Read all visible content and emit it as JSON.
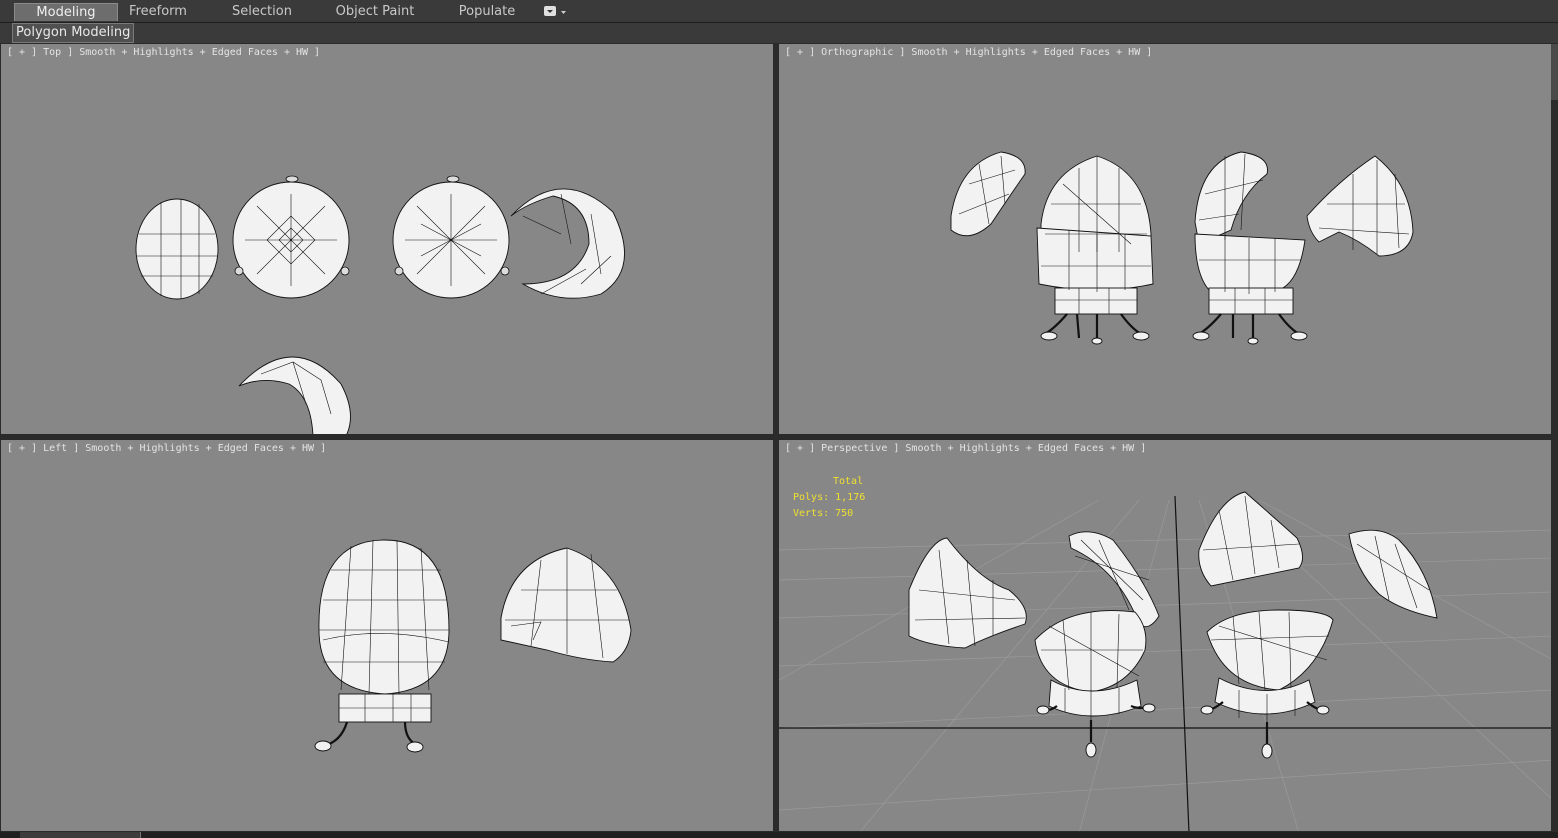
{
  "ribbon": {
    "tabs": [
      "Modeling",
      "Freeform",
      "Selection",
      "Object Paint",
      "Populate"
    ],
    "active_tab": "Modeling",
    "sub_label": "Polygon Modeling"
  },
  "viewports": [
    {
      "id": "top",
      "label": "[ + ] Top ] Smooth + Highlights + Edged Faces + HW ]"
    },
    {
      "id": "orthographic",
      "label": "[ + ] Orthographic ] Smooth + Highlights + Edged Faces + HW ]"
    },
    {
      "id": "left",
      "label": "[ + ] Left ] Smooth + Highlights + Edged Faces + HW ]"
    },
    {
      "id": "perspective",
      "label": "[ + ] Perspective ] Smooth + Highlights + Edged Faces + HW ]"
    }
  ],
  "stats": {
    "header": "Total",
    "polys": "Polys: 1,176",
    "verts": "Verts: 750"
  },
  "colors": {
    "viewport_bg": "#878787",
    "stats_text": "#f0e030",
    "mesh_fill": "#f2f2f2",
    "wire": "#111111"
  }
}
